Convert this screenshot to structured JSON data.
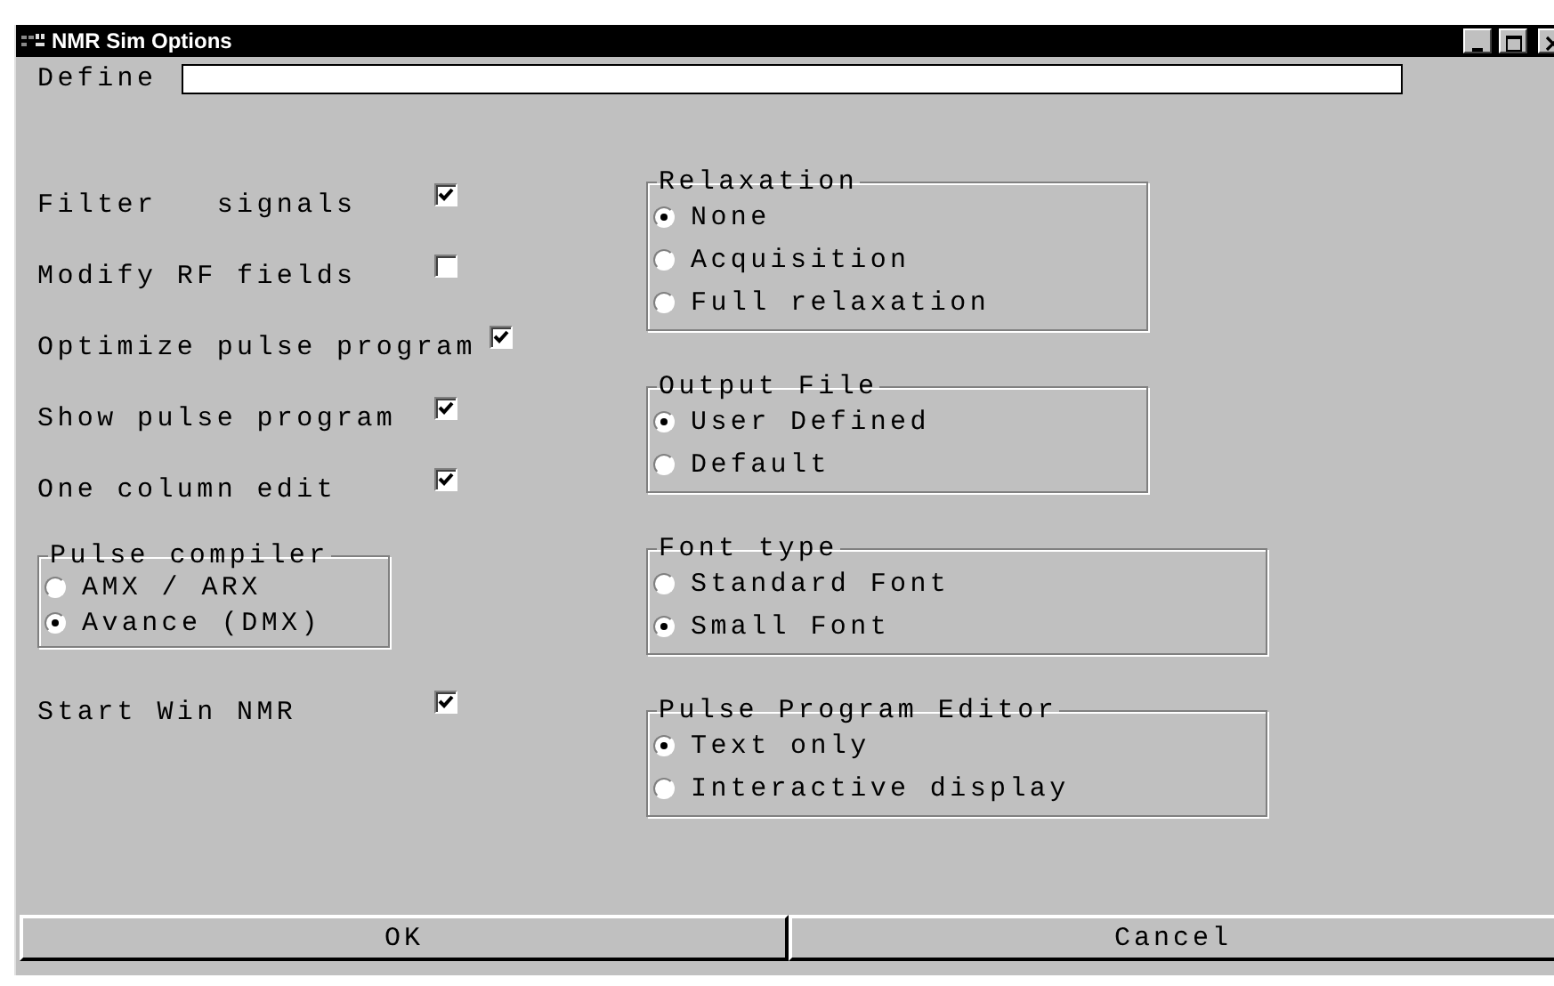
{
  "window": {
    "title": "NMR Sim Options"
  },
  "define": {
    "label": "Define"
  },
  "options": [
    {
      "label": "Filter   signals",
      "checked": true
    },
    {
      "label": "Modify RF fields",
      "checked": false
    },
    {
      "label": "Optimize pulse program",
      "checked": true
    },
    {
      "label": "Show pulse program",
      "checked": true
    },
    {
      "label": "One column edit",
      "checked": true
    }
  ],
  "pulse_compiler": {
    "title": "Pulse compiler",
    "options": [
      {
        "label": "AMX / ARX",
        "selected": false
      },
      {
        "label": "Avance (DMX)",
        "selected": true
      }
    ]
  },
  "start_option": {
    "label": "Start Win NMR",
    "checked": true
  },
  "groups": [
    {
      "title": "Relaxation",
      "options": [
        {
          "label": "None",
          "selected": true
        },
        {
          "label": "Acquisition",
          "selected": false
        },
        {
          "label": "Full relaxation",
          "selected": false
        }
      ]
    },
    {
      "title": "Output File",
      "options": [
        {
          "label": "User Defined",
          "selected": true
        },
        {
          "label": "Default",
          "selected": false
        }
      ]
    },
    {
      "title": "Font type",
      "options": [
        {
          "label": "Standard Font",
          "selected": false
        },
        {
          "label": "Small Font",
          "selected": true
        }
      ]
    },
    {
      "title": "Pulse Program Editor",
      "options": [
        {
          "label": "Text only",
          "selected": true
        },
        {
          "label": "Interactive display",
          "selected": false
        }
      ]
    }
  ],
  "buttons": [
    "OK",
    "Cancel"
  ]
}
